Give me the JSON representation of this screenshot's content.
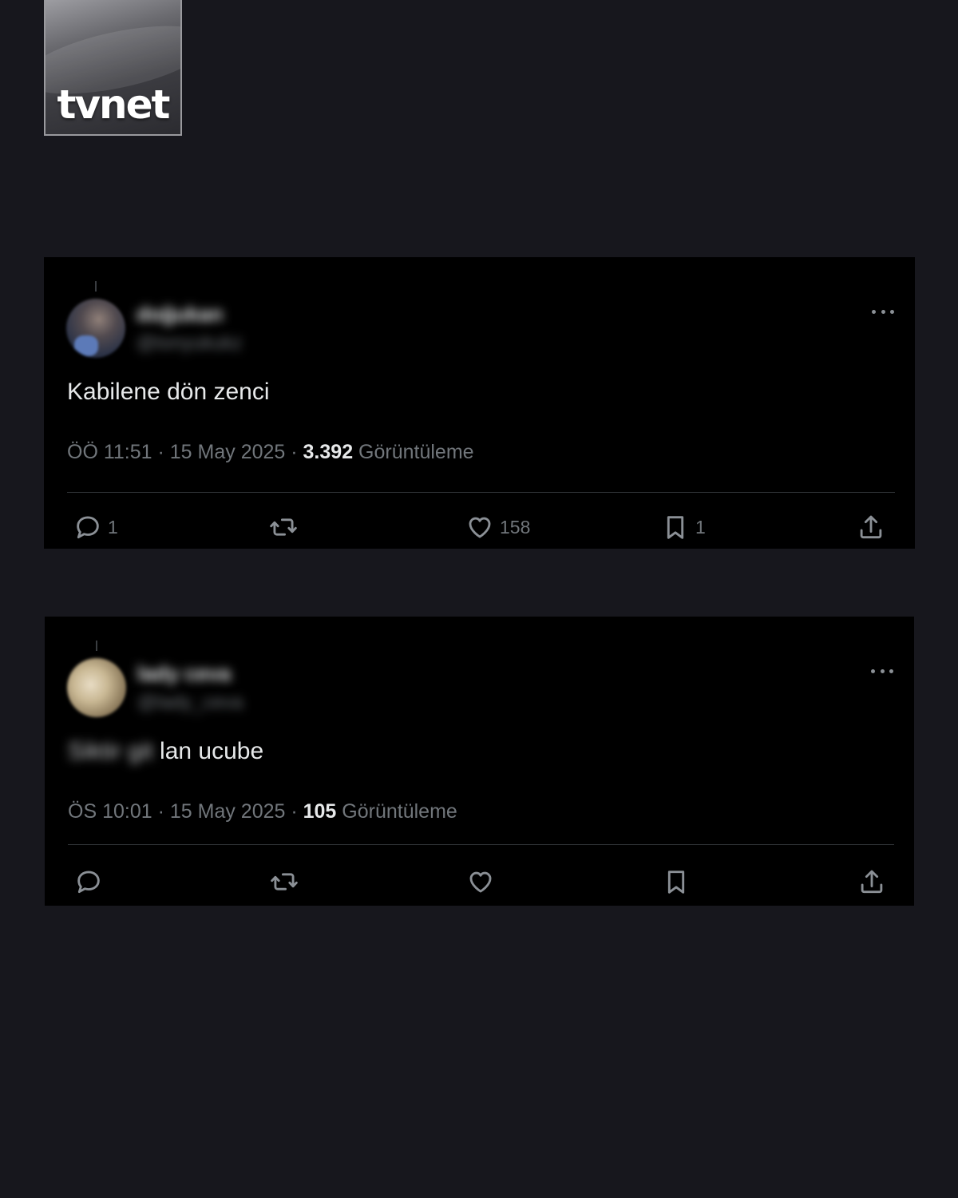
{
  "logo": {
    "text": "tvnet"
  },
  "tweets": [
    {
      "display_name": "doğukan",
      "handle": "@tonyukukz",
      "text_blurred": "",
      "text": "Kabilene dön zenci",
      "time": "ÖÖ 11:51",
      "date": "15 May 2025",
      "views_count": "3.392",
      "views_label": "Görüntüleme",
      "reply_count": "1",
      "retweet_count": "",
      "like_count": "158",
      "bookmark_count": "1"
    },
    {
      "display_name": "lady ceva",
      "handle": "@lady_ceva",
      "text_blurred": "Siktir git",
      "text": "lan ucube",
      "time": "ÖS 10:01",
      "date": "15 May 2025",
      "views_count": "105",
      "views_label": "Görüntüleme",
      "reply_count": "",
      "retweet_count": "",
      "like_count": "",
      "bookmark_count": ""
    }
  ],
  "icons": {
    "reply": "reply-icon",
    "retweet": "retweet-icon",
    "like": "heart-icon",
    "bookmark": "bookmark-icon",
    "share": "share-icon",
    "more": "more-icon"
  },
  "colors": {
    "page_background": "#17171d",
    "card_background": "#000000",
    "primary_text": "#e7e9ea",
    "secondary_text": "#71767b"
  }
}
